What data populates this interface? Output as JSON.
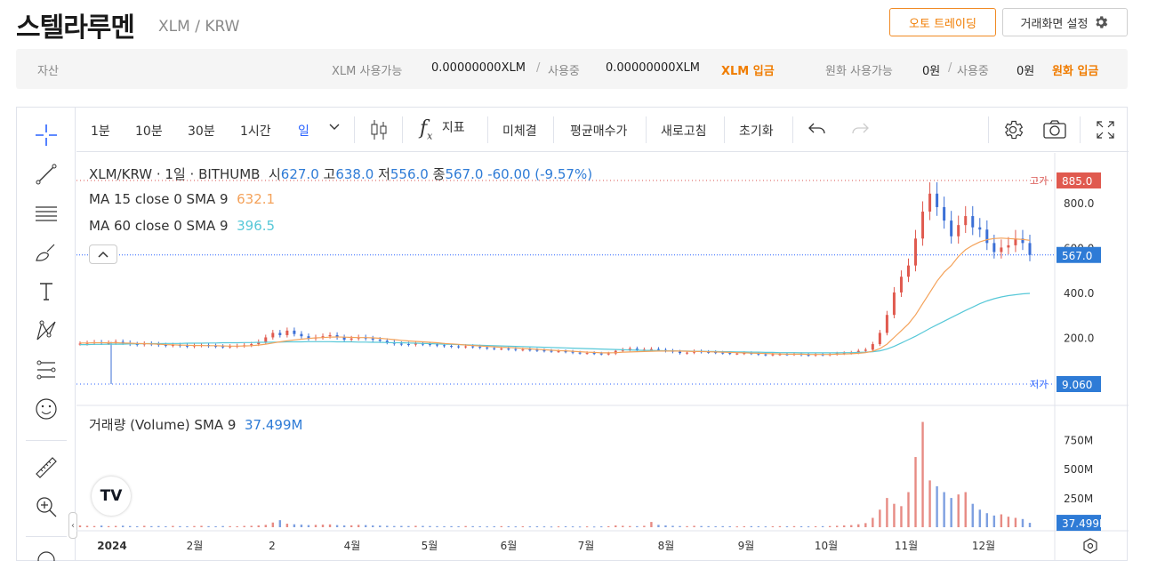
{
  "header": {
    "title": "스텔라루멘",
    "pair": "XLM / KRW",
    "auto_trading": "오토 트레이딩",
    "screen_settings": "거래화면 설정"
  },
  "assets": {
    "label": "자산",
    "xlm_avail_label": "XLM 사용가능",
    "xlm_avail": "0.00000000XLM",
    "sep": "/",
    "in_use_label": "사용중",
    "xlm_in_use": "0.00000000XLM",
    "xlm_deposit": "XLM 입금",
    "krw_avail_label": "원화 사용가능",
    "krw_avail": "0원",
    "krw_in_use": "0원",
    "krw_deposit": "원화 입금"
  },
  "toolbar": {
    "tf_1m": "1분",
    "tf_10m": "10분",
    "tf_30m": "30분",
    "tf_1h": "1시간",
    "tf_day": "일",
    "indicators": "지표",
    "fx": "f",
    "unfilled": "미체결",
    "avg_price": "평균매수가",
    "refresh": "새로고침",
    "reset": "초기화"
  },
  "legend": {
    "symbol": "XLM/KRW · 1일 · BITHUMB",
    "o_label": "시",
    "o": "627.0",
    "h_label": "고",
    "h": "638.0",
    "l_label": "저",
    "l": "556.0",
    "c_label": "종",
    "c": "567.0",
    "change": "-60.00 (-9.57%)",
    "ma15_label": "MA 15 close 0 SMA 9",
    "ma15": "632.1",
    "ma60_label": "MA 60 close 0 SMA 9",
    "ma60": "396.5",
    "vol_label": "거래량 (Volume) SMA 9",
    "vol": "37.499M"
  },
  "chart_data": {
    "type": "candlestick",
    "symbol": "XLM/KRW",
    "interval": "1일",
    "exchange": "BITHUMB",
    "x_ticks": [
      "2024",
      "2월",
      "2",
      "4월",
      "5월",
      "6월",
      "7월",
      "8월",
      "9월",
      "10월",
      "11월",
      "12월"
    ],
    "y_ticks": [
      "800.0",
      "600.0",
      "400.0",
      "200.0"
    ],
    "high_label": "고가",
    "high_value": "885.0",
    "low_label": "저가",
    "low_value": "9.060",
    "last_price": "567.0",
    "vol_ticks": [
      "750M",
      "500M",
      "250M"
    ],
    "last_volume": "37.499M",
    "ylim": [
      0,
      950
    ],
    "vol_ylim": [
      0,
      950
    ],
    "close": [
      172,
      175,
      178,
      175,
      176,
      180,
      176,
      170,
      168,
      172,
      170,
      166,
      164,
      166,
      163,
      160,
      164,
      166,
      162,
      160,
      158,
      160,
      162,
      165,
      170,
      180,
      200,
      220,
      210,
      230,
      215,
      205,
      195,
      200,
      205,
      210,
      200,
      190,
      195,
      200,
      195,
      190,
      185,
      178,
      172,
      170,
      168,
      172,
      170,
      168,
      165,
      162,
      160,
      158,
      160,
      158,
      155,
      152,
      150,
      150,
      148,
      145,
      146,
      144,
      142,
      140,
      138,
      138,
      136,
      132,
      130,
      130,
      128,
      126,
      128,
      140,
      145,
      150,
      142,
      146,
      148,
      144,
      140,
      136,
      130,
      132,
      138,
      135,
      134,
      132,
      130,
      128,
      128,
      130,
      128,
      124,
      122,
      124,
      125,
      124,
      126,
      122,
      120,
      124,
      122,
      125,
      128,
      130,
      132,
      140,
      145,
      170,
      220,
      300,
      400,
      470,
      520,
      640,
      760,
      840,
      780,
      720,
      650,
      700,
      740,
      690,
      680,
      620,
      580,
      600,
      610,
      640,
      620,
      567
    ],
    "ma15": [
      175,
      175,
      176,
      176,
      176,
      176,
      175,
      174,
      173,
      172,
      171,
      170,
      168,
      167,
      166,
      165,
      164,
      164,
      163,
      163,
      162,
      161,
      161,
      162,
      163,
      166,
      170,
      175,
      180,
      185,
      189,
      192,
      195,
      198,
      199,
      201,
      202,
      201,
      200,
      199,
      199,
      198,
      196,
      193,
      190,
      187,
      184,
      182,
      180,
      178,
      176,
      173,
      171,
      169,
      166,
      164,
      162,
      160,
      158,
      156,
      155,
      153,
      151,
      149,
      147,
      145,
      143,
      141,
      140,
      138,
      136,
      134,
      133,
      131,
      131,
      132,
      134,
      135,
      136,
      137,
      138,
      139,
      139,
      139,
      139,
      138,
      137,
      137,
      136,
      135,
      134,
      133,
      132,
      131,
      130,
      129,
      128,
      127,
      126,
      125,
      125,
      125,
      124,
      124,
      124,
      124,
      125,
      126,
      127,
      129,
      132,
      138,
      150,
      170,
      200,
      230,
      260,
      300,
      350,
      400,
      450,
      490,
      520,
      560,
      590,
      610,
      625,
      635,
      640,
      642,
      640,
      638,
      636,
      632
    ],
    "ma60": [
      168,
      168,
      169,
      169,
      170,
      170,
      170,
      171,
      171,
      172,
      172,
      172,
      173,
      173,
      173,
      174,
      174,
      174,
      175,
      175,
      176,
      176,
      176,
      177,
      177,
      178,
      178,
      179,
      179,
      180,
      180,
      180,
      181,
      181,
      181,
      181,
      180,
      180,
      180,
      179,
      179,
      178,
      178,
      177,
      176,
      176,
      175,
      174,
      173,
      172,
      171,
      170,
      169,
      168,
      167,
      166,
      165,
      164,
      163,
      162,
      161,
      160,
      159,
      158,
      157,
      156,
      155,
      154,
      153,
      152,
      151,
      150,
      149,
      148,
      147,
      146,
      145,
      144,
      143,
      142,
      142,
      141,
      140,
      140,
      139,
      139,
      138,
      138,
      137,
      137,
      136,
      136,
      135,
      135,
      134,
      134,
      133,
      133,
      132,
      132,
      132,
      131,
      131,
      131,
      131,
      131,
      131,
      132,
      132,
      133,
      134,
      136,
      140,
      148,
      160,
      175,
      190,
      205,
      222,
      240,
      256,
      272,
      288,
      304,
      320,
      335,
      350,
      362,
      372,
      380,
      386,
      390,
      394,
      396
    ],
    "volume": [
      15,
      12,
      10,
      14,
      9,
      11,
      13,
      10,
      8,
      12,
      9,
      10,
      8,
      11,
      9,
      8,
      10,
      12,
      9,
      8,
      10,
      9,
      8,
      11,
      12,
      15,
      20,
      40,
      60,
      30,
      25,
      22,
      18,
      20,
      22,
      24,
      18,
      15,
      16,
      20,
      18,
      15,
      14,
      12,
      10,
      11,
      10,
      12,
      11,
      10,
      9,
      8,
      9,
      8,
      10,
      9,
      8,
      7,
      8,
      9,
      8,
      7,
      8,
      7,
      8,
      7,
      6,
      7,
      8,
      7,
      6,
      7,
      6,
      7,
      8,
      15,
      12,
      10,
      9,
      12,
      45,
      20,
      15,
      12,
      10,
      9,
      12,
      10,
      9,
      8,
      9,
      8,
      7,
      8,
      9,
      8,
      7,
      8,
      9,
      8,
      9,
      8,
      7,
      8,
      9,
      10,
      12,
      15,
      18,
      25,
      35,
      80,
      150,
      250,
      200,
      180,
      300,
      600,
      900,
      400,
      350,
      300,
      250,
      280,
      300,
      200,
      150,
      120,
      100,
      110,
      90,
      80,
      70,
      37.499
    ]
  }
}
